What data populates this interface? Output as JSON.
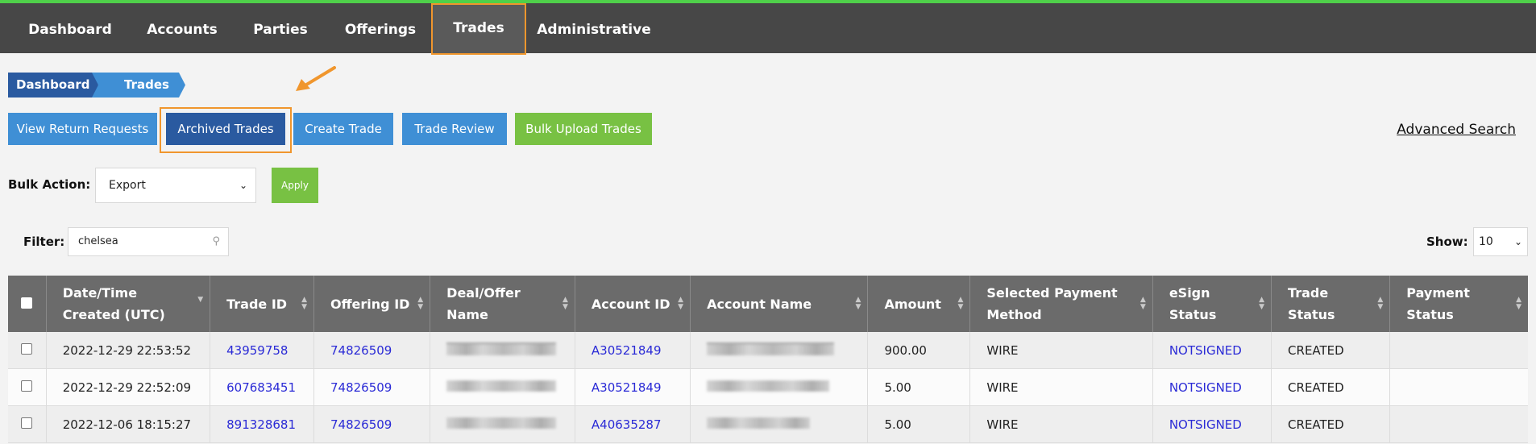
{
  "nav": {
    "items": [
      "Dashboard",
      "Accounts",
      "Parties",
      "Offerings",
      "Trades",
      "Administrative"
    ],
    "active": "Trades"
  },
  "breadcrumb": [
    "Dashboard",
    "Trades"
  ],
  "toolbar": {
    "view_return_requests": "View Return Requests",
    "archived_trades": "Archived Trades",
    "create_trade": "Create Trade",
    "trade_review": "Trade Review",
    "bulk_upload_trades": "Bulk Upload Trades",
    "advanced_search": "Advanced Search"
  },
  "bulk_action": {
    "label": "Bulk Action:",
    "selected": "Export",
    "apply_label": "Apply"
  },
  "filter": {
    "label": "Filter:",
    "value": "chelsea"
  },
  "show": {
    "label": "Show:",
    "selected": "10"
  },
  "table": {
    "headers": [
      "Date/Time Created (UTC)",
      "Trade ID",
      "Offering ID",
      "Deal/Offer Name",
      "Account ID",
      "Account Name",
      "Amount",
      "Selected Payment Method",
      "eSign Status",
      "Trade Status",
      "Payment Status"
    ],
    "rows": [
      {
        "date": "2022-12-29 22:53:52",
        "trade_id": "43959758",
        "offering_id": "74826509",
        "account_id": "A30521849",
        "amount": "900.00",
        "payment_method": "WIRE",
        "esign": "NOTSIGNED",
        "trade_status": "CREATED",
        "payment_status": ""
      },
      {
        "date": "2022-12-29 22:52:09",
        "trade_id": "607683451",
        "offering_id": "74826509",
        "account_id": "A30521849",
        "amount": "5.00",
        "payment_method": "WIRE",
        "esign": "NOTSIGNED",
        "trade_status": "CREATED",
        "payment_status": ""
      },
      {
        "date": "2022-12-06 18:15:27",
        "trade_id": "891328681",
        "offering_id": "74826509",
        "account_id": "A40635287",
        "amount": "5.00",
        "payment_method": "WIRE",
        "esign": "NOTSIGNED",
        "trade_status": "CREATED",
        "payment_status": ""
      }
    ]
  },
  "colors": {
    "nav_bg": "#474747",
    "accent_green": "#78c143",
    "accent_blue": "#3f8fd5",
    "accent_navy": "#2a5aa0",
    "highlight_orange": "#f0962d",
    "link": "#2b2bd6"
  }
}
